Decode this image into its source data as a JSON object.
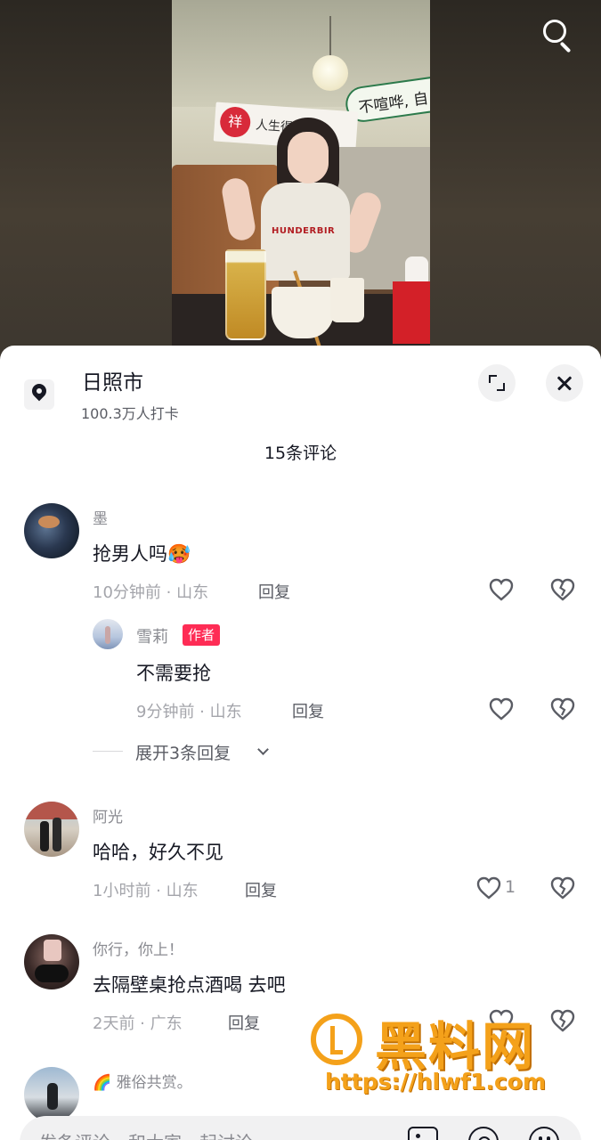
{
  "location": {
    "name": "日照市",
    "checkins": "100.3万人打卡"
  },
  "comments_header": {
    "title": "15条评论"
  },
  "comments": [
    {
      "user": "墨",
      "text": "抢男人吗🥵",
      "meta": "10分钟前 · 山东",
      "reply_label": "回复",
      "reply": {
        "user": "雪莉",
        "badge": "作者",
        "text": "不需要抢",
        "meta": "9分钟前 · 山东",
        "reply_label": "回复"
      },
      "expand": "展开3条回复"
    },
    {
      "user": "阿光",
      "text": "哈哈，好久不见",
      "meta": "1小时前 · 山东",
      "reply_label": "回复",
      "likes": "1"
    },
    {
      "user": "你行，你上！",
      "text": "去隔壁桌抢点酒喝  去吧",
      "meta": "2天前 · 广东",
      "reply_label": "回复"
    },
    {
      "user": "🌈 雅俗共赏。"
    }
  ],
  "input": {
    "placeholder": "发条评论，和大家一起讨论"
  },
  "video": {
    "banner_right": "不喧哗, 自",
    "banner_left": "人生得",
    "seal": "祥",
    "shirt_print": "HUNDERBIR"
  },
  "watermark": {
    "title": "黑料网",
    "url": "https://hlwf1.com"
  },
  "icons": [
    "search-icon",
    "location-pin-icon",
    "expand-icon",
    "close-icon",
    "heart-icon",
    "broken-heart-icon",
    "chevron-down-icon",
    "image-icon",
    "at-icon",
    "emoji-icon"
  ],
  "colors": {
    "accent": "#fe2c55",
    "text_primary": "#161823",
    "text_secondary": "#8a8b91",
    "watermark": "#f4a11a"
  }
}
